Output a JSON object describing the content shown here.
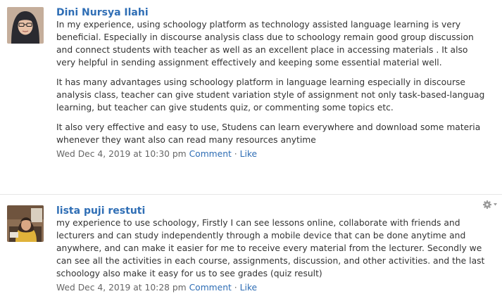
{
  "posts": [
    {
      "author": "Dini Nursya Ilahi",
      "paragraphs": [
        [
          "In my experience, using schoology platform as technology assisted language learning is  very",
          "beneficial. Especially in discourse analysis class due to schoology remain good group discussion",
          "and connect students with teacher as well as an excellent place  in accessing materials .  It also",
          "very helpful in sending assignment effectively and keeping some essential material well."
        ],
        [
          "It has many advantages using schoology platform in language learning especially in discourse",
          "analysis class, teacher can give student variation style of assignment not only task-based-languag",
          "learning, but teacher can give students quiz, or commenting some topics etc."
        ],
        [
          "It also very effective and easy to use, Studens can learn everywhere and download some materia",
          "whenever they want also can read many resources anytime"
        ]
      ],
      "timestamp": "Wed Dec 4, 2019 at 10:30 pm",
      "comment_label": "Comment",
      "separator": "·",
      "like_label": "Like"
    },
    {
      "author": "lista puji restuti",
      "paragraphs": [
        [
          "my experience to use schoology, Firstly I can see lessons online, collaborate with friends and",
          "lecturers and can study independently through a mobile device that can be done anytime and",
          "anywhere, and can make it easier for me to receive every material from the lecturer. Secondly we",
          "can see all the activities in each course, assignments, discussion, and other activities. and the last",
          "schoology also make it easy for us to see grades (quiz result)"
        ]
      ],
      "timestamp": "Wed Dec 4, 2019 at 10:28 pm",
      "comment_label": "Comment",
      "separator": "·",
      "like_label": "Like",
      "options_icon": "gear-icon"
    }
  ],
  "colors": {
    "link": "#2f6eb5",
    "text": "#333333",
    "meta": "#666666",
    "divider": "#e6e6e6"
  }
}
